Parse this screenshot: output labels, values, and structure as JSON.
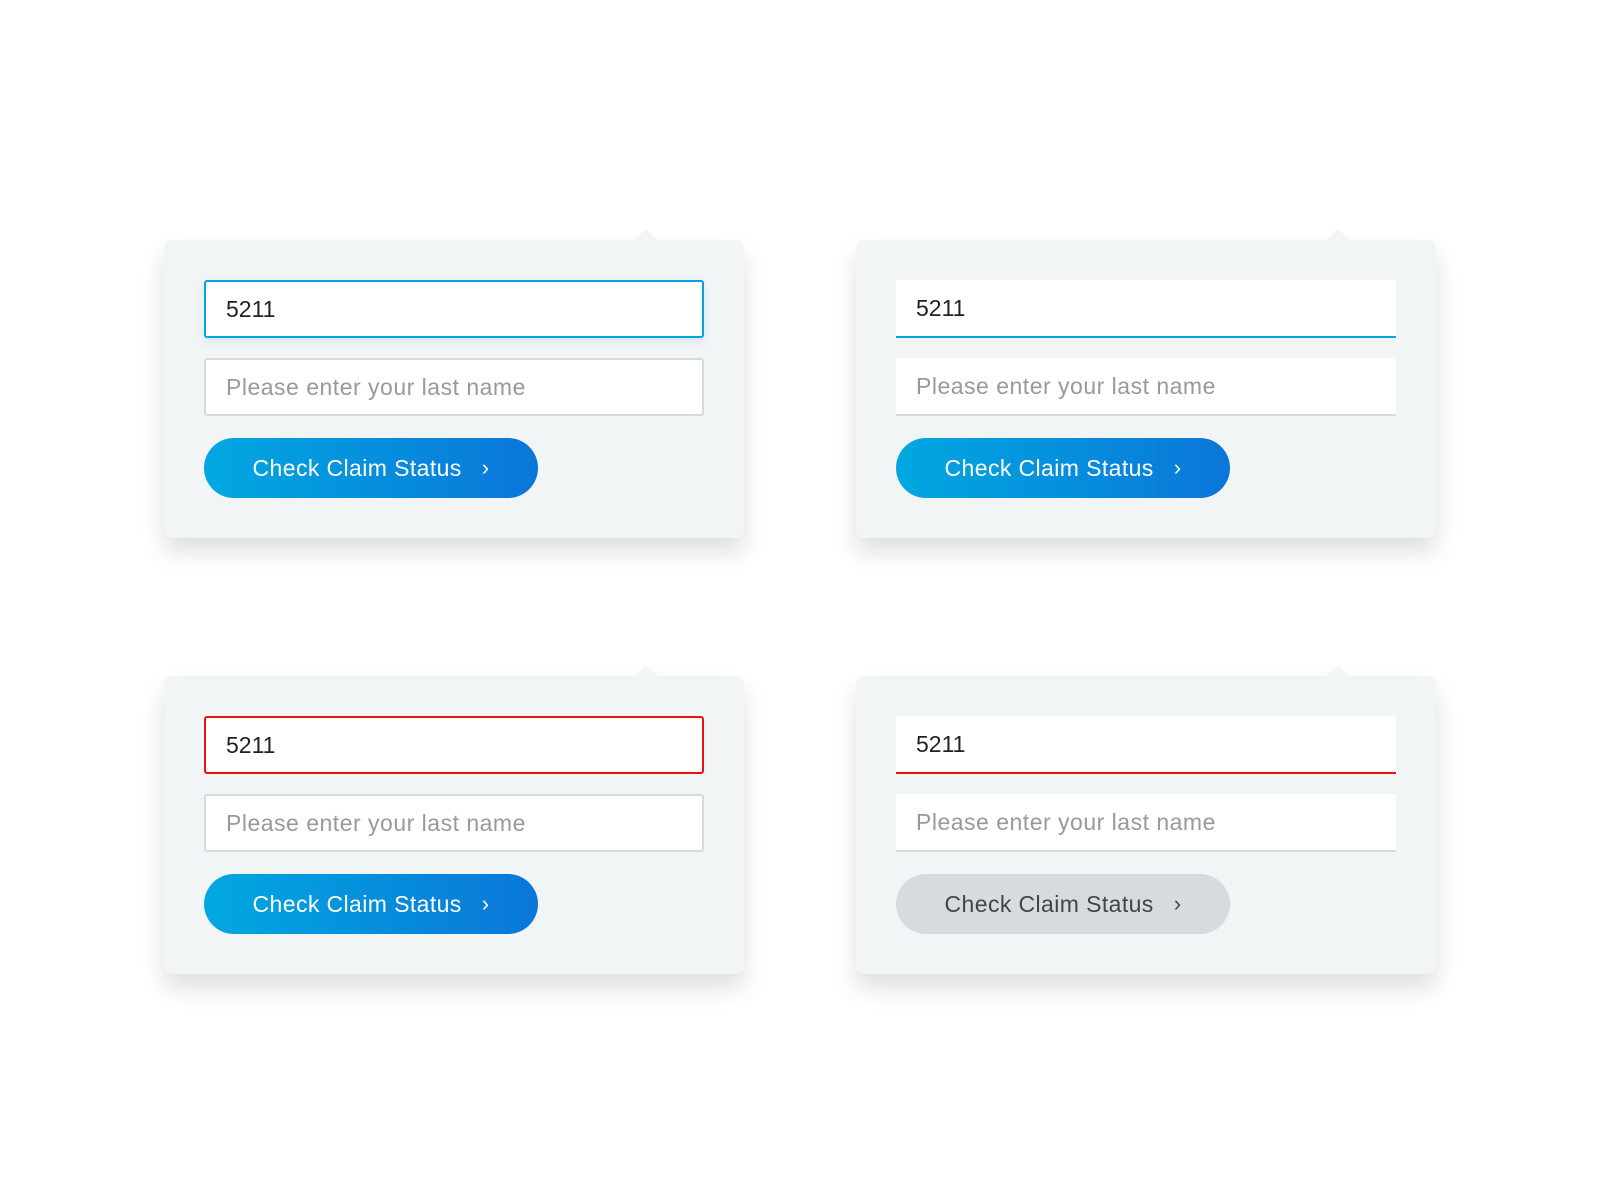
{
  "colors": {
    "focus": "#00a6e2",
    "error": "#ee1111",
    "button_gradient_start": "#00a8e0",
    "button_gradient_end": "#0b76d9",
    "disabled": "#d5dbdf"
  },
  "cards": [
    {
      "style": "boxed",
      "state": "focus",
      "claim_value": "5211",
      "name_placeholder": "Please enter your last name",
      "button_label": "Check Claim Status",
      "button_icon": "chevron-right-icon"
    },
    {
      "style": "underline",
      "state": "focus",
      "claim_value": "5211",
      "name_placeholder": "Please enter your last name",
      "button_label": "Check Claim Status",
      "button_icon": "chevron-right-icon"
    },
    {
      "style": "boxed",
      "state": "error",
      "claim_value": "5211",
      "name_placeholder": "Please enter your last name",
      "button_label": "Check Claim Status",
      "button_icon": "chevron-right-icon"
    },
    {
      "style": "underline",
      "state": "error",
      "claim_value": "5211",
      "name_placeholder": "Please enter your last name",
      "button_label": "Check Claim Status",
      "button_icon": "chevron-right-icon",
      "button_disabled": true
    }
  ],
  "chevron": "›"
}
